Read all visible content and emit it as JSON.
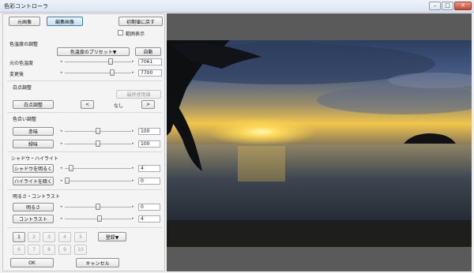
{
  "window": {
    "title": "色彩コントローラ"
  },
  "top_buttons": {
    "original": "元画像",
    "edited": "編集画像",
    "reset": "初期値に戻す"
  },
  "range_display": {
    "label": "範囲表示",
    "checked": false
  },
  "color_temp": {
    "section": "色温度の調整",
    "preset_button": "色温度のプリセット▼",
    "auto_button": "自動",
    "original_label": "元の色温度",
    "original_value": "7061",
    "original_level": 0.7,
    "converted_label": "変更後",
    "converted_value": "7700",
    "converted_level": 0.73
  },
  "white_point": {
    "section": "白点調整",
    "last_used_button": "最終使用値",
    "point_button": "白点調整",
    "prev": "<",
    "next": ">",
    "status": "なし"
  },
  "tint": {
    "section": "色合い調整",
    "red_label": "赤味",
    "red_value": "100",
    "red_level": 0.5,
    "green_label": "緑味",
    "green_value": "100",
    "green_level": 0.5
  },
  "shadow_highlight": {
    "section": "シャドウ・ハイライト",
    "shadow_label": "シャドウを明るく",
    "shadow_value": "4",
    "shadow_level": 0.07,
    "highlight_label": "ハイライトを暗く",
    "highlight_value": "0",
    "highlight_level": 0.0
  },
  "brightness_contrast": {
    "section": "明るさ・コントラスト",
    "brightness_label": "明るさ",
    "brightness_value": "0",
    "brightness_level": 0.5,
    "contrast_label": "コントラスト",
    "contrast_value": "4",
    "contrast_level": 0.52
  },
  "presets": {
    "slots_row1": [
      "1",
      "2",
      "3",
      "4",
      "5"
    ],
    "slots_row2": [
      "6",
      "7",
      "8",
      "9",
      "10"
    ],
    "register_button": "登録▼"
  },
  "footer": {
    "ok": "OK",
    "cancel": "キャンセル"
  },
  "colors": {
    "accent": "#3c7fb1",
    "preview_bg": "#5a5a5a"
  }
}
